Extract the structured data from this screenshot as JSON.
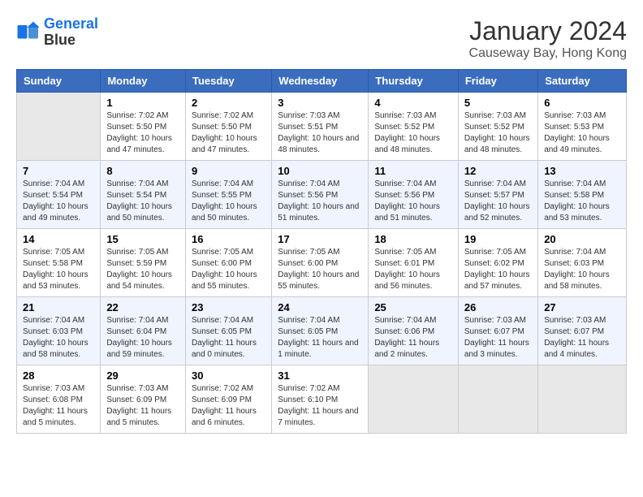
{
  "header": {
    "logo_line1": "General",
    "logo_line2": "Blue",
    "month_year": "January 2024",
    "location": "Causeway Bay, Hong Kong"
  },
  "columns": [
    "Sunday",
    "Monday",
    "Tuesday",
    "Wednesday",
    "Thursday",
    "Friday",
    "Saturday"
  ],
  "weeks": [
    [
      {
        "day": "",
        "sunrise": "",
        "sunset": "",
        "daylight": ""
      },
      {
        "day": "1",
        "sunrise": "Sunrise: 7:02 AM",
        "sunset": "Sunset: 5:50 PM",
        "daylight": "Daylight: 10 hours and 47 minutes."
      },
      {
        "day": "2",
        "sunrise": "Sunrise: 7:02 AM",
        "sunset": "Sunset: 5:50 PM",
        "daylight": "Daylight: 10 hours and 47 minutes."
      },
      {
        "day": "3",
        "sunrise": "Sunrise: 7:03 AM",
        "sunset": "Sunset: 5:51 PM",
        "daylight": "Daylight: 10 hours and 48 minutes."
      },
      {
        "day": "4",
        "sunrise": "Sunrise: 7:03 AM",
        "sunset": "Sunset: 5:52 PM",
        "daylight": "Daylight: 10 hours and 48 minutes."
      },
      {
        "day": "5",
        "sunrise": "Sunrise: 7:03 AM",
        "sunset": "Sunset: 5:52 PM",
        "daylight": "Daylight: 10 hours and 48 minutes."
      },
      {
        "day": "6",
        "sunrise": "Sunrise: 7:03 AM",
        "sunset": "Sunset: 5:53 PM",
        "daylight": "Daylight: 10 hours and 49 minutes."
      }
    ],
    [
      {
        "day": "7",
        "sunrise": "Sunrise: 7:04 AM",
        "sunset": "Sunset: 5:54 PM",
        "daylight": "Daylight: 10 hours and 49 minutes."
      },
      {
        "day": "8",
        "sunrise": "Sunrise: 7:04 AM",
        "sunset": "Sunset: 5:54 PM",
        "daylight": "Daylight: 10 hours and 50 minutes."
      },
      {
        "day": "9",
        "sunrise": "Sunrise: 7:04 AM",
        "sunset": "Sunset: 5:55 PM",
        "daylight": "Daylight: 10 hours and 50 minutes."
      },
      {
        "day": "10",
        "sunrise": "Sunrise: 7:04 AM",
        "sunset": "Sunset: 5:56 PM",
        "daylight": "Daylight: 10 hours and 51 minutes."
      },
      {
        "day": "11",
        "sunrise": "Sunrise: 7:04 AM",
        "sunset": "Sunset: 5:56 PM",
        "daylight": "Daylight: 10 hours and 51 minutes."
      },
      {
        "day": "12",
        "sunrise": "Sunrise: 7:04 AM",
        "sunset": "Sunset: 5:57 PM",
        "daylight": "Daylight: 10 hours and 52 minutes."
      },
      {
        "day": "13",
        "sunrise": "Sunrise: 7:04 AM",
        "sunset": "Sunset: 5:58 PM",
        "daylight": "Daylight: 10 hours and 53 minutes."
      }
    ],
    [
      {
        "day": "14",
        "sunrise": "Sunrise: 7:05 AM",
        "sunset": "Sunset: 5:58 PM",
        "daylight": "Daylight: 10 hours and 53 minutes."
      },
      {
        "day": "15",
        "sunrise": "Sunrise: 7:05 AM",
        "sunset": "Sunset: 5:59 PM",
        "daylight": "Daylight: 10 hours and 54 minutes."
      },
      {
        "day": "16",
        "sunrise": "Sunrise: 7:05 AM",
        "sunset": "Sunset: 6:00 PM",
        "daylight": "Daylight: 10 hours and 55 minutes."
      },
      {
        "day": "17",
        "sunrise": "Sunrise: 7:05 AM",
        "sunset": "Sunset: 6:00 PM",
        "daylight": "Daylight: 10 hours and 55 minutes."
      },
      {
        "day": "18",
        "sunrise": "Sunrise: 7:05 AM",
        "sunset": "Sunset: 6:01 PM",
        "daylight": "Daylight: 10 hours and 56 minutes."
      },
      {
        "day": "19",
        "sunrise": "Sunrise: 7:05 AM",
        "sunset": "Sunset: 6:02 PM",
        "daylight": "Daylight: 10 hours and 57 minutes."
      },
      {
        "day": "20",
        "sunrise": "Sunrise: 7:04 AM",
        "sunset": "Sunset: 6:03 PM",
        "daylight": "Daylight: 10 hours and 58 minutes."
      }
    ],
    [
      {
        "day": "21",
        "sunrise": "Sunrise: 7:04 AM",
        "sunset": "Sunset: 6:03 PM",
        "daylight": "Daylight: 10 hours and 58 minutes."
      },
      {
        "day": "22",
        "sunrise": "Sunrise: 7:04 AM",
        "sunset": "Sunset: 6:04 PM",
        "daylight": "Daylight: 10 hours and 59 minutes."
      },
      {
        "day": "23",
        "sunrise": "Sunrise: 7:04 AM",
        "sunset": "Sunset: 6:05 PM",
        "daylight": "Daylight: 11 hours and 0 minutes."
      },
      {
        "day": "24",
        "sunrise": "Sunrise: 7:04 AM",
        "sunset": "Sunset: 6:05 PM",
        "daylight": "Daylight: 11 hours and 1 minute."
      },
      {
        "day": "25",
        "sunrise": "Sunrise: 7:04 AM",
        "sunset": "Sunset: 6:06 PM",
        "daylight": "Daylight: 11 hours and 2 minutes."
      },
      {
        "day": "26",
        "sunrise": "Sunrise: 7:03 AM",
        "sunset": "Sunset: 6:07 PM",
        "daylight": "Daylight: 11 hours and 3 minutes."
      },
      {
        "day": "27",
        "sunrise": "Sunrise: 7:03 AM",
        "sunset": "Sunset: 6:07 PM",
        "daylight": "Daylight: 11 hours and 4 minutes."
      }
    ],
    [
      {
        "day": "28",
        "sunrise": "Sunrise: 7:03 AM",
        "sunset": "Sunset: 6:08 PM",
        "daylight": "Daylight: 11 hours and 5 minutes."
      },
      {
        "day": "29",
        "sunrise": "Sunrise: 7:03 AM",
        "sunset": "Sunset: 6:09 PM",
        "daylight": "Daylight: 11 hours and 5 minutes."
      },
      {
        "day": "30",
        "sunrise": "Sunrise: 7:02 AM",
        "sunset": "Sunset: 6:09 PM",
        "daylight": "Daylight: 11 hours and 6 minutes."
      },
      {
        "day": "31",
        "sunrise": "Sunrise: 7:02 AM",
        "sunset": "Sunset: 6:10 PM",
        "daylight": "Daylight: 11 hours and 7 minutes."
      },
      {
        "day": "",
        "sunrise": "",
        "sunset": "",
        "daylight": ""
      },
      {
        "day": "",
        "sunrise": "",
        "sunset": "",
        "daylight": ""
      },
      {
        "day": "",
        "sunrise": "",
        "sunset": "",
        "daylight": ""
      }
    ]
  ]
}
